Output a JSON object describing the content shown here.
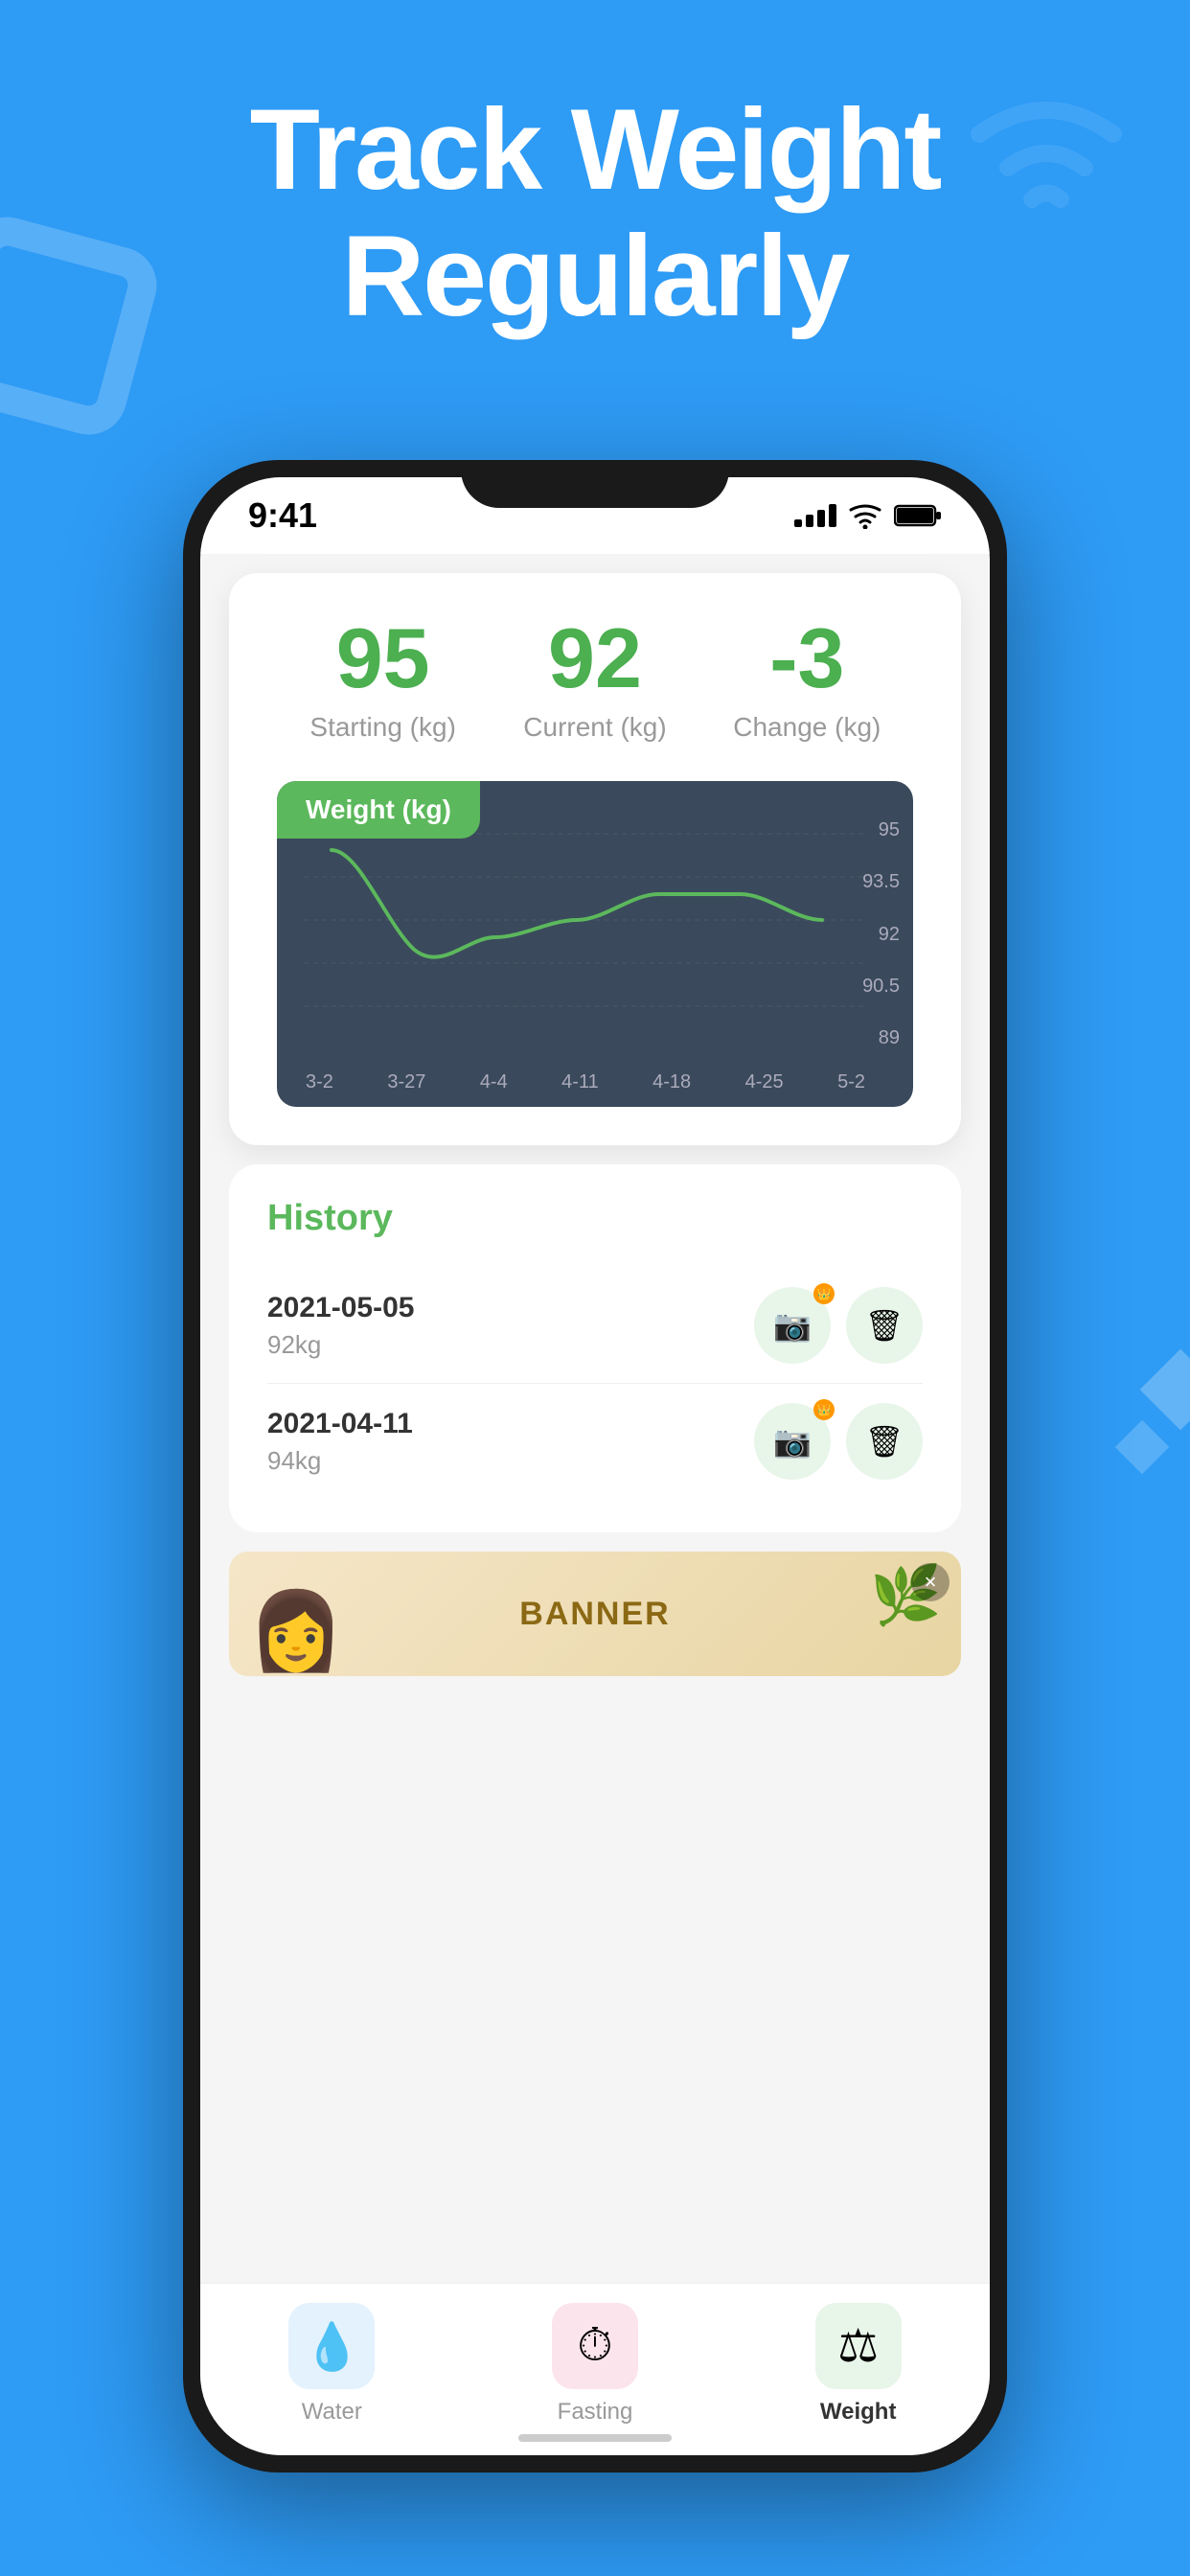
{
  "page": {
    "background_color": "#2E9BF5"
  },
  "title": {
    "line1": "Track Weight",
    "line2": "Regularly"
  },
  "status_bar": {
    "time": "9:41"
  },
  "stats": {
    "starting_value": "95",
    "starting_label": "Starting (kg)",
    "current_value": "92",
    "current_label": "Current (kg)",
    "change_value": "-3",
    "change_label": "Change (kg)"
  },
  "chart": {
    "title": "Weight  (kg)",
    "y_labels": [
      "95",
      "93.5",
      "92",
      "90.5",
      "89"
    ],
    "x_labels": [
      "3-2",
      "3-27",
      "4-4",
      "4-11",
      "4-18",
      "4-25",
      "5-2"
    ]
  },
  "history": {
    "title": "History",
    "items": [
      {
        "date": "2021-05-05",
        "weight": "92kg"
      },
      {
        "date": "2021-04-11",
        "weight": "94kg"
      }
    ]
  },
  "banner": {
    "text": "BANNER",
    "close_label": "×"
  },
  "tabs": [
    {
      "id": "water",
      "label": "Water",
      "icon": "💧",
      "active": false
    },
    {
      "id": "fasting",
      "label": "Fasting",
      "icon": "⏱",
      "active": false
    },
    {
      "id": "weight",
      "label": "Weight",
      "icon": "⚖",
      "active": true
    }
  ]
}
